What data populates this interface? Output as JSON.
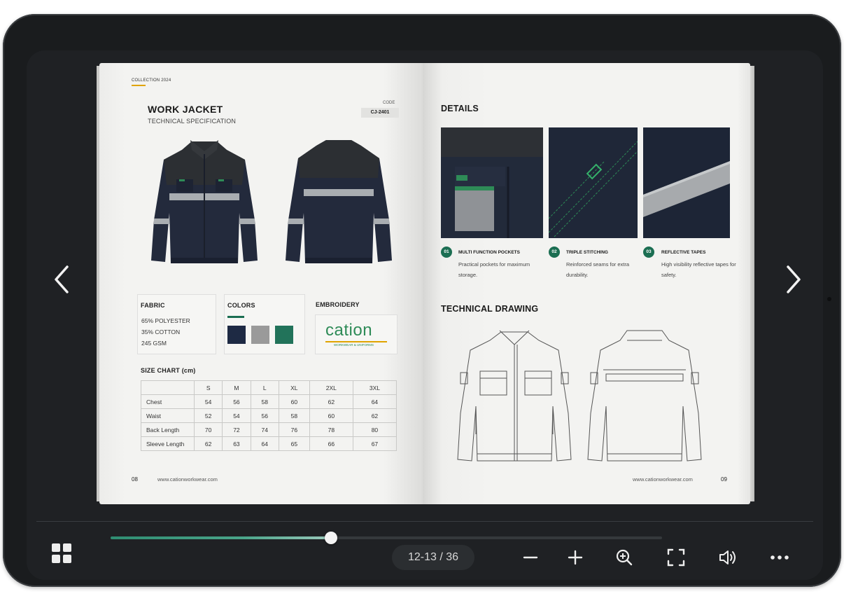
{
  "left_page": {
    "collection": "COLLECTION 2024",
    "title": "WORK JACKET",
    "subtitle": "TECHNICAL SPECIFICATION",
    "code_label": "CODE",
    "code": "CJ-2401",
    "fabric": {
      "heading": "FABRIC",
      "lines": [
        "65% POLYESTER",
        "35% COTTON",
        "245 GSM"
      ]
    },
    "colors": {
      "heading": "COLORS",
      "swatches": [
        "#1e2a44",
        "#9a9a9a",
        "#22735a"
      ]
    },
    "embroidery": {
      "heading": "EMBROIDERY",
      "brand": "cation",
      "tagline": "WORKWEAR & UNIFORMS"
    },
    "size_chart": {
      "heading": "SIZE CHART (cm)",
      "columns": [
        "",
        "S",
        "M",
        "L",
        "XL",
        "2XL",
        "3XL"
      ],
      "rows": [
        [
          "Chest",
          "54",
          "56",
          "58",
          "60",
          "62",
          "64"
        ],
        [
          "Waist",
          "52",
          "54",
          "56",
          "58",
          "60",
          "62"
        ],
        [
          "Back Length",
          "70",
          "72",
          "74",
          "76",
          "78",
          "80"
        ],
        [
          "Sleeve Length",
          "62",
          "63",
          "64",
          "65",
          "66",
          "67"
        ]
      ]
    },
    "page_number": "08",
    "url": "www.cationworkwear.com"
  },
  "right_page": {
    "details_heading": "DETAILS",
    "details": [
      {
        "num": "01",
        "title": "MULTI FUNCTION POCKETS",
        "desc": "Practical pockets for maximum storage."
      },
      {
        "num": "02",
        "title": "TRIPLE STITCHING",
        "desc": "Reinforced seams for extra durability."
      },
      {
        "num": "03",
        "title": "REFLECTIVE TAPES",
        "desc": "High visibility reflective tapes for safety."
      }
    ],
    "drawing_heading": "TECHNICAL DRAWING",
    "url": "www.cationworkwear.com",
    "page_number": "09"
  },
  "viewer": {
    "page_indicator": "12-13 / 36",
    "progress": 0.4,
    "buttons": [
      "grid-icon",
      "prev-icon",
      "next-icon",
      "zoom-out-icon",
      "zoom-in-icon",
      "search-zoom-icon",
      "fullscreen-icon",
      "sound-icon",
      "more-icon"
    ]
  },
  "colors": {
    "accent": "#2f8d72",
    "background": "#1f2124",
    "brand_green": "#1b6e52"
  }
}
